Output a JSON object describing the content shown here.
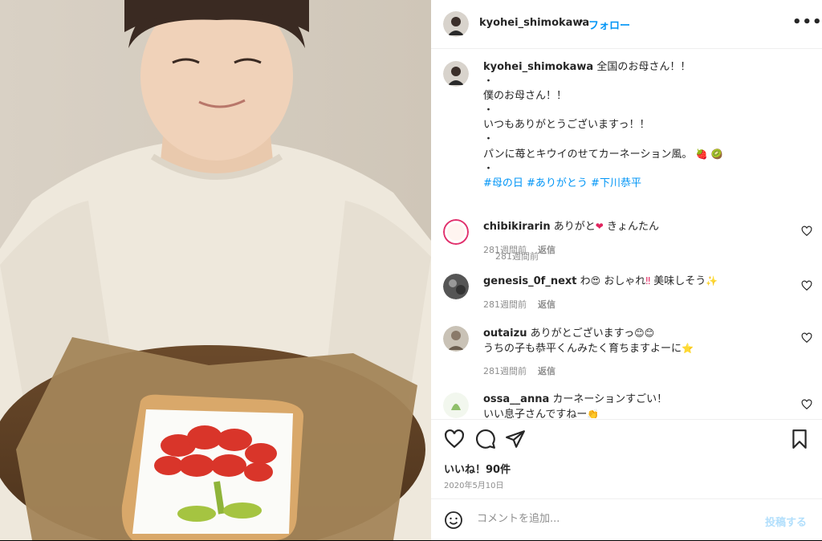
{
  "header": {
    "username": "kyohei_shimokawa",
    "separator": "•",
    "follow_label": "フォロー",
    "more_label": "•••"
  },
  "caption": {
    "username": "kyohei_shimokawa",
    "lines": [
      "全国のお母さん！！",
      "・",
      "僕のお母さん！！",
      "・",
      "いつもありがとうございますっ！！",
      "・",
      "パンに苺とキウイのせてカーネーション風。",
      "・"
    ],
    "hashtags": "#母の日 #ありがとう #下川恭平",
    "time": "281週間前"
  },
  "comments": [
    {
      "username": "chibikirarin",
      "text": "ありがと",
      "text2": "きょんたん",
      "time": "281週間前",
      "reply": "返信"
    },
    {
      "username": "genesis_0f_next",
      "text": "わ",
      "text2": "おしゃれ",
      "text3": "美味しそう",
      "time": "281週間前",
      "reply": "返信"
    },
    {
      "username": "outaizu",
      "text": "ありがとございますっ",
      "line2": "うちの子も恭平くんみたく育ちますよーに",
      "time": "281週間前",
      "reply": "返信"
    },
    {
      "username": "ossa__anna",
      "text": "カーネーションすごい！",
      "line2": "いい息子さんですねー"
    }
  ],
  "actions": {
    "likes": "いいね！90件",
    "date": "2020年5月10日"
  },
  "comment_bar": {
    "placeholder": "コメントを追加...",
    "post_label": "投稿する"
  },
  "colors": {
    "accent": "#0095f6",
    "muted": "#8e8e8e",
    "text": "#262626"
  }
}
